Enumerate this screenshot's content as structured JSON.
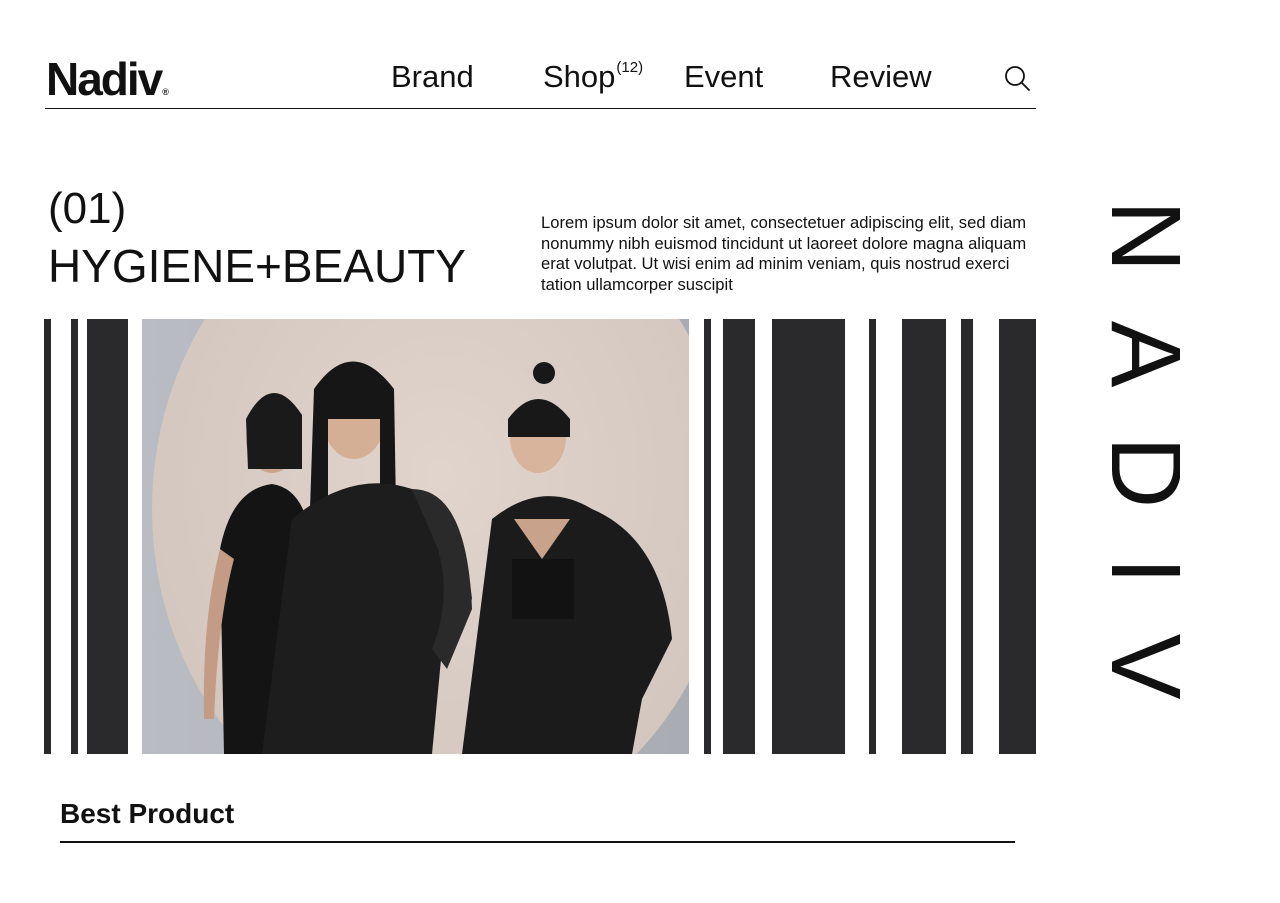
{
  "brand": {
    "logo_text": "Nadiv",
    "logo_mark": "®",
    "vertical_text": "NADIV"
  },
  "nav": {
    "items": [
      {
        "label": "Brand"
      },
      {
        "label": "Shop",
        "badge": "(12)"
      },
      {
        "label": "Event"
      },
      {
        "label": "Review"
      }
    ],
    "search_icon": "search-icon"
  },
  "hero": {
    "number": "(01)",
    "title": "HYGIENE+BEAUTY",
    "description": "Lorem ipsum dolor sit amet, consectetuer adipiscing elit, sed diam nonummy nibh euismod tincidunt ut laoreet dolore magna aliquam erat volutpat. Ut wisi enim ad minim veniam, quis nostrud exerci tation ullamcorper suscipit"
  },
  "section": {
    "best_product_title": "Best Product"
  },
  "colors": {
    "ink": "#111111",
    "bars": "#2a2a2c",
    "background": "#ffffff"
  }
}
